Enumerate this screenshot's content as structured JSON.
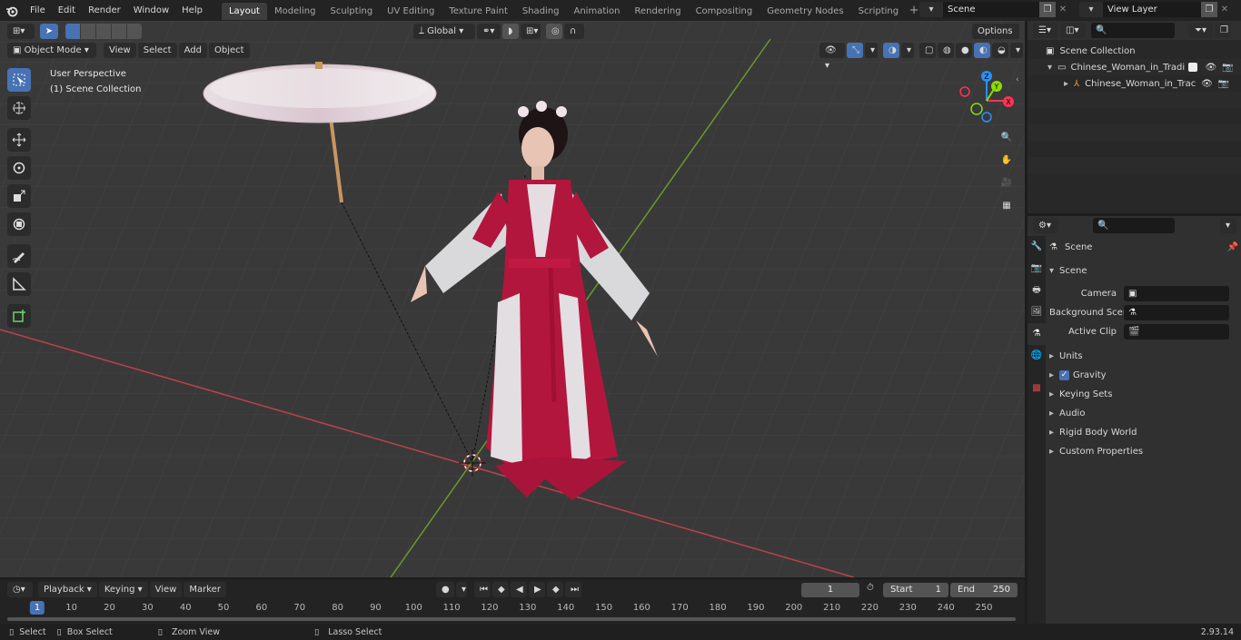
{
  "topbar": {
    "menus": [
      "File",
      "Edit",
      "Render",
      "Window",
      "Help"
    ],
    "workspaces": [
      "Layout",
      "Modeling",
      "Sculpting",
      "UV Editing",
      "Texture Paint",
      "Shading",
      "Animation",
      "Rendering",
      "Compositing",
      "Geometry Nodes",
      "Scripting"
    ],
    "active_workspace": "Layout",
    "scene_name": "Scene",
    "view_layer": "View Layer"
  },
  "viewport": {
    "mode": "Object Mode",
    "menus": [
      "View",
      "Select",
      "Add",
      "Object"
    ],
    "transform_orientation": "Global",
    "options_label": "Options",
    "overlay_title": "User Perspective",
    "overlay_collection": "(1) Scene Collection",
    "gizmo_axes": [
      "Z",
      "Y",
      "X"
    ]
  },
  "outliner": {
    "root": "Scene Collection",
    "collection": "Chinese_Woman_in_Tradition",
    "object": "Chinese_Woman_in_Trac"
  },
  "properties": {
    "header_title": "Scene",
    "section": "Scene",
    "fields": [
      {
        "label": "Camera"
      },
      {
        "label": "Background Scene"
      },
      {
        "label": "Active Clip"
      }
    ],
    "panels": [
      "Units",
      "Gravity",
      "Keying Sets",
      "Audio",
      "Rigid Body World",
      "Custom Properties"
    ]
  },
  "timeline": {
    "menus": [
      "Playback",
      "Keying",
      "View",
      "Marker"
    ],
    "current_frame": "1",
    "start_label": "Start",
    "start_value": "1",
    "end_label": "End",
    "end_value": "250",
    "ruler": [
      "1",
      "10",
      "20",
      "30",
      "40",
      "50",
      "60",
      "70",
      "80",
      "90",
      "100",
      "110",
      "120",
      "130",
      "140",
      "150",
      "160",
      "170",
      "180",
      "190",
      "200",
      "210",
      "220",
      "230",
      "240",
      "250"
    ]
  },
  "statusbar": {
    "select": "Select",
    "box_select": "Box Select",
    "zoom_view": "Zoom View",
    "lasso_select": "Lasso Select",
    "version": "2.93.14"
  },
  "colors": {
    "accent": "#4772b3",
    "x_axis": "#ff3352",
    "y_axis": "#8bdc00",
    "z_axis": "#2890ff",
    "dress_red": "#b3163c"
  }
}
